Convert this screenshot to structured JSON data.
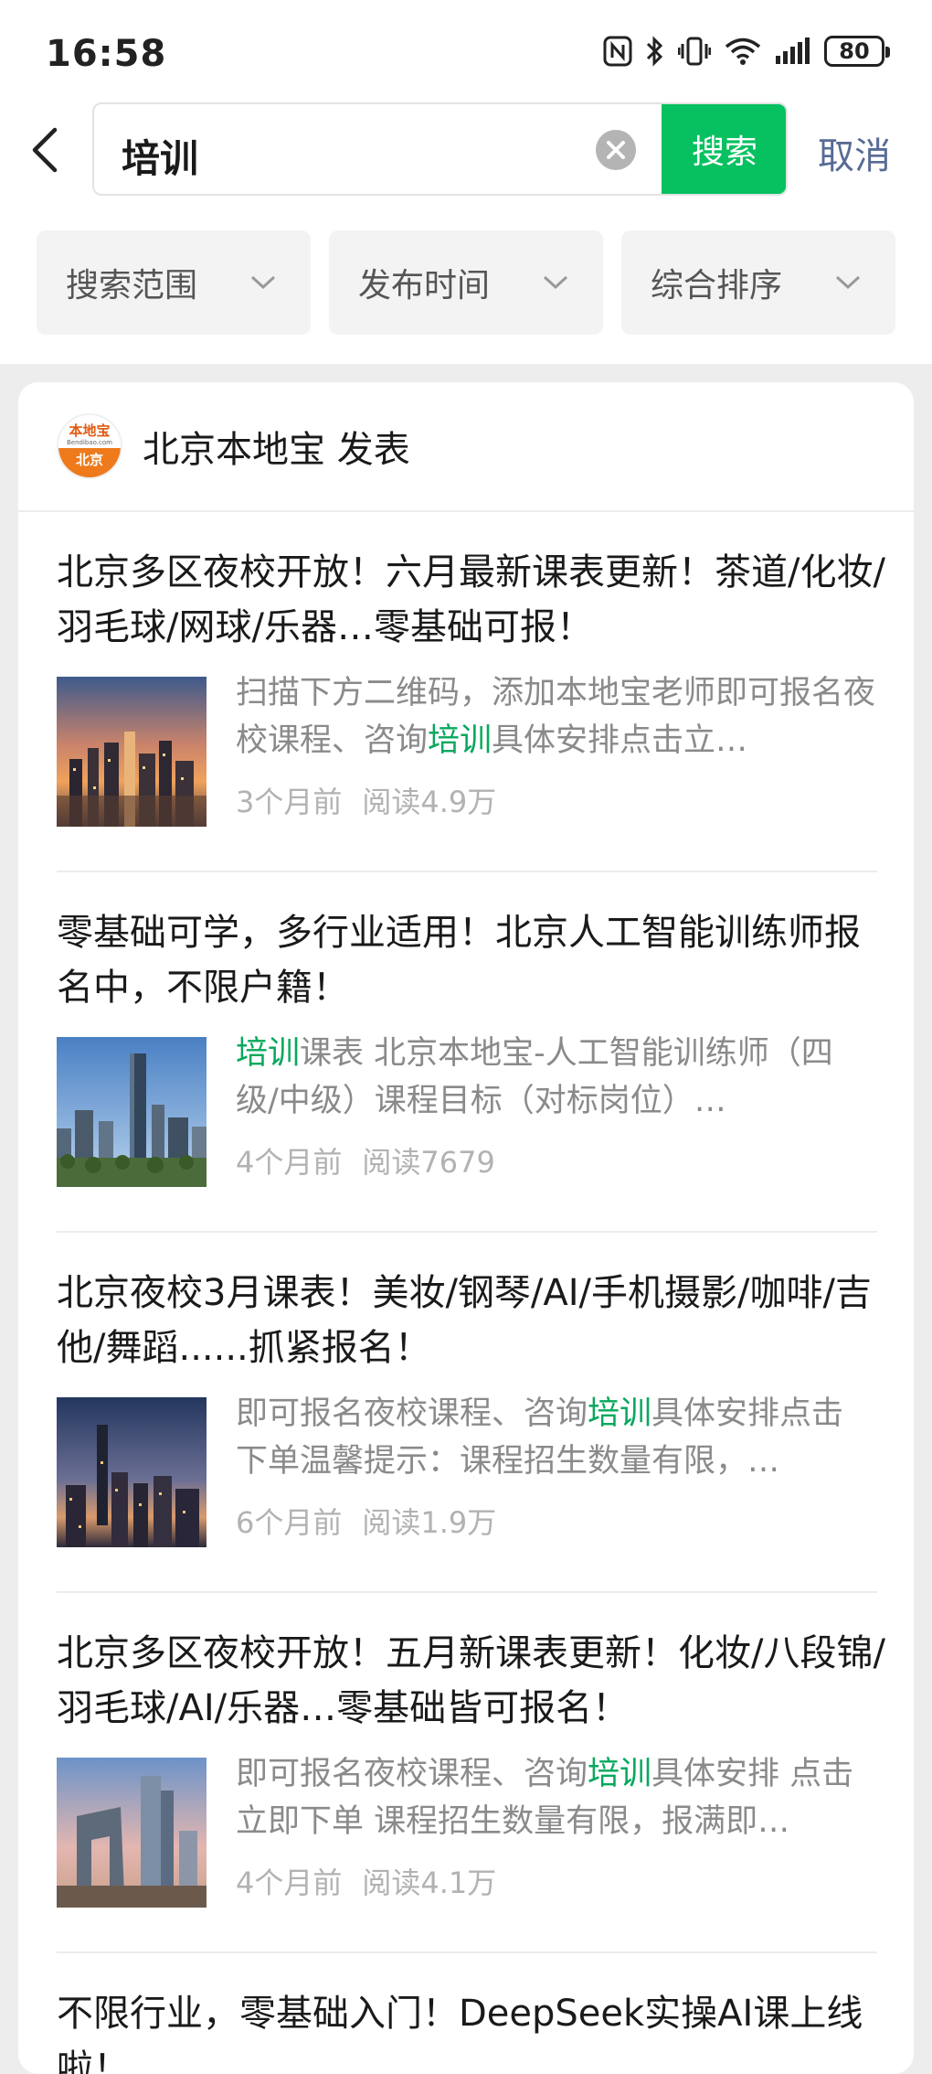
{
  "status_bar": {
    "time": "16:58",
    "battery": "80"
  },
  "search": {
    "query": "培训",
    "button": "搜索",
    "cancel": "取消"
  },
  "filters": [
    "搜索范围",
    "发布时间",
    "综合排序"
  ],
  "account": {
    "logo_text_top": "本地宝",
    "logo_text_mid": "Bendibao.com",
    "logo_text_bottom": "北京",
    "name": "北京本地宝 发表"
  },
  "articles": [
    {
      "title": "北京多区夜校开放！六月最新课表更新！茶道/化妆/羽毛球/网球/乐器…零基础可报！",
      "snippet_before": "扫描下方二维码，添加本地宝老师即可报名夜校课程、咨询",
      "highlight": "培训",
      "snippet_after": "具体安排点击立…",
      "time": "3个月前",
      "reads": "阅读4.9万"
    },
    {
      "title": "零基础可学，多行业适用！北京人工智能训练师报名中，不限户籍！",
      "snippet_before": "",
      "highlight": "培训",
      "snippet_after": "课表 北京本地宝-人工智能训练师（四级/中级）课程目标（对标岗位）…",
      "time": "4个月前",
      "reads": "阅读7679"
    },
    {
      "title": "北京夜校3月课表！美妆/钢琴/AI/手机摄影/咖啡/吉他/舞蹈......抓紧报名！",
      "snippet_before": "即可报名夜校课程、咨询",
      "highlight": "培训",
      "snippet_after": "具体安排点击下单温馨提示：课程招生数量有限，…",
      "time": "6个月前",
      "reads": "阅读1.9万"
    },
    {
      "title": "北京多区夜校开放！五月新课表更新！化妆/八段锦/羽毛球/AI/乐器…零基础皆可报名！",
      "snippet_before": "即可报名夜校课程、咨询",
      "highlight": "培训",
      "snippet_after": "具体安排 点击立即下单 课程招生数量有限，报满即…",
      "time": "4个月前",
      "reads": "阅读4.1万"
    },
    {
      "title": "不限行业，零基础入门！DeepSeek实操AI课上线啦！"
    }
  ],
  "colors": {
    "accent_green": "#07c160",
    "link_blue": "#576b95",
    "highlight_green": "#07a85c"
  }
}
